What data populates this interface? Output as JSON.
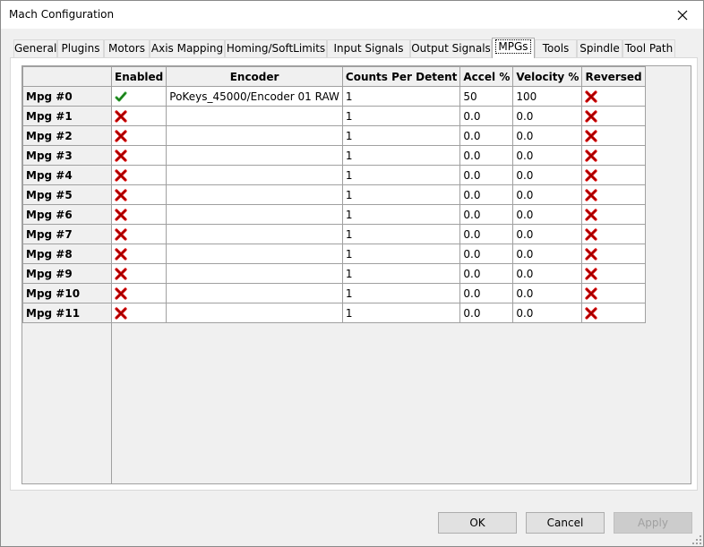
{
  "window": {
    "title": "Mach Configuration"
  },
  "tabs": [
    "General",
    "Plugins",
    "Motors",
    "Axis Mapping",
    "Homing/SoftLimits",
    "Input Signals",
    "Output Signals",
    "MPGs",
    "Tools",
    "Spindle",
    "Tool Path"
  ],
  "active_tab": "MPGs",
  "grid": {
    "columns": [
      "Enabled",
      "Encoder",
      "Counts Per Detent",
      "Accel %",
      "Velocity %",
      "Reversed"
    ],
    "rows": [
      {
        "name": "Mpg #0",
        "enabled": true,
        "encoder": "PoKeys_45000/Encoder 01 RAW",
        "counts": "1",
        "accel": "50",
        "velocity": "100",
        "reversed": false
      },
      {
        "name": "Mpg #1",
        "enabled": false,
        "encoder": "",
        "counts": "1",
        "accel": "0.0",
        "velocity": "0.0",
        "reversed": false
      },
      {
        "name": "Mpg #2",
        "enabled": false,
        "encoder": "",
        "counts": "1",
        "accel": "0.0",
        "velocity": "0.0",
        "reversed": false
      },
      {
        "name": "Mpg #3",
        "enabled": false,
        "encoder": "",
        "counts": "1",
        "accel": "0.0",
        "velocity": "0.0",
        "reversed": false
      },
      {
        "name": "Mpg #4",
        "enabled": false,
        "encoder": "",
        "counts": "1",
        "accel": "0.0",
        "velocity": "0.0",
        "reversed": false
      },
      {
        "name": "Mpg #5",
        "enabled": false,
        "encoder": "",
        "counts": "1",
        "accel": "0.0",
        "velocity": "0.0",
        "reversed": false
      },
      {
        "name": "Mpg #6",
        "enabled": false,
        "encoder": "",
        "counts": "1",
        "accel": "0.0",
        "velocity": "0.0",
        "reversed": false
      },
      {
        "name": "Mpg #7",
        "enabled": false,
        "encoder": "",
        "counts": "1",
        "accel": "0.0",
        "velocity": "0.0",
        "reversed": false
      },
      {
        "name": "Mpg #8",
        "enabled": false,
        "encoder": "",
        "counts": "1",
        "accel": "0.0",
        "velocity": "0.0",
        "reversed": false
      },
      {
        "name": "Mpg #9",
        "enabled": false,
        "encoder": "",
        "counts": "1",
        "accel": "0.0",
        "velocity": "0.0",
        "reversed": false
      },
      {
        "name": "Mpg #10",
        "enabled": false,
        "encoder": "",
        "counts": "1",
        "accel": "0.0",
        "velocity": "0.0",
        "reversed": false
      },
      {
        "name": "Mpg #11",
        "enabled": false,
        "encoder": "",
        "counts": "1",
        "accel": "0.0",
        "velocity": "0.0",
        "reversed": false
      }
    ]
  },
  "buttons": {
    "ok": "OK",
    "cancel": "Cancel",
    "apply": "Apply",
    "apply_enabled": false
  },
  "colors": {
    "check": "#2e9e2e",
    "cross": "#d40000"
  },
  "icons": {
    "enabled_true": "green-check-icon",
    "enabled_false": "red-x-icon",
    "close": "close-icon"
  }
}
